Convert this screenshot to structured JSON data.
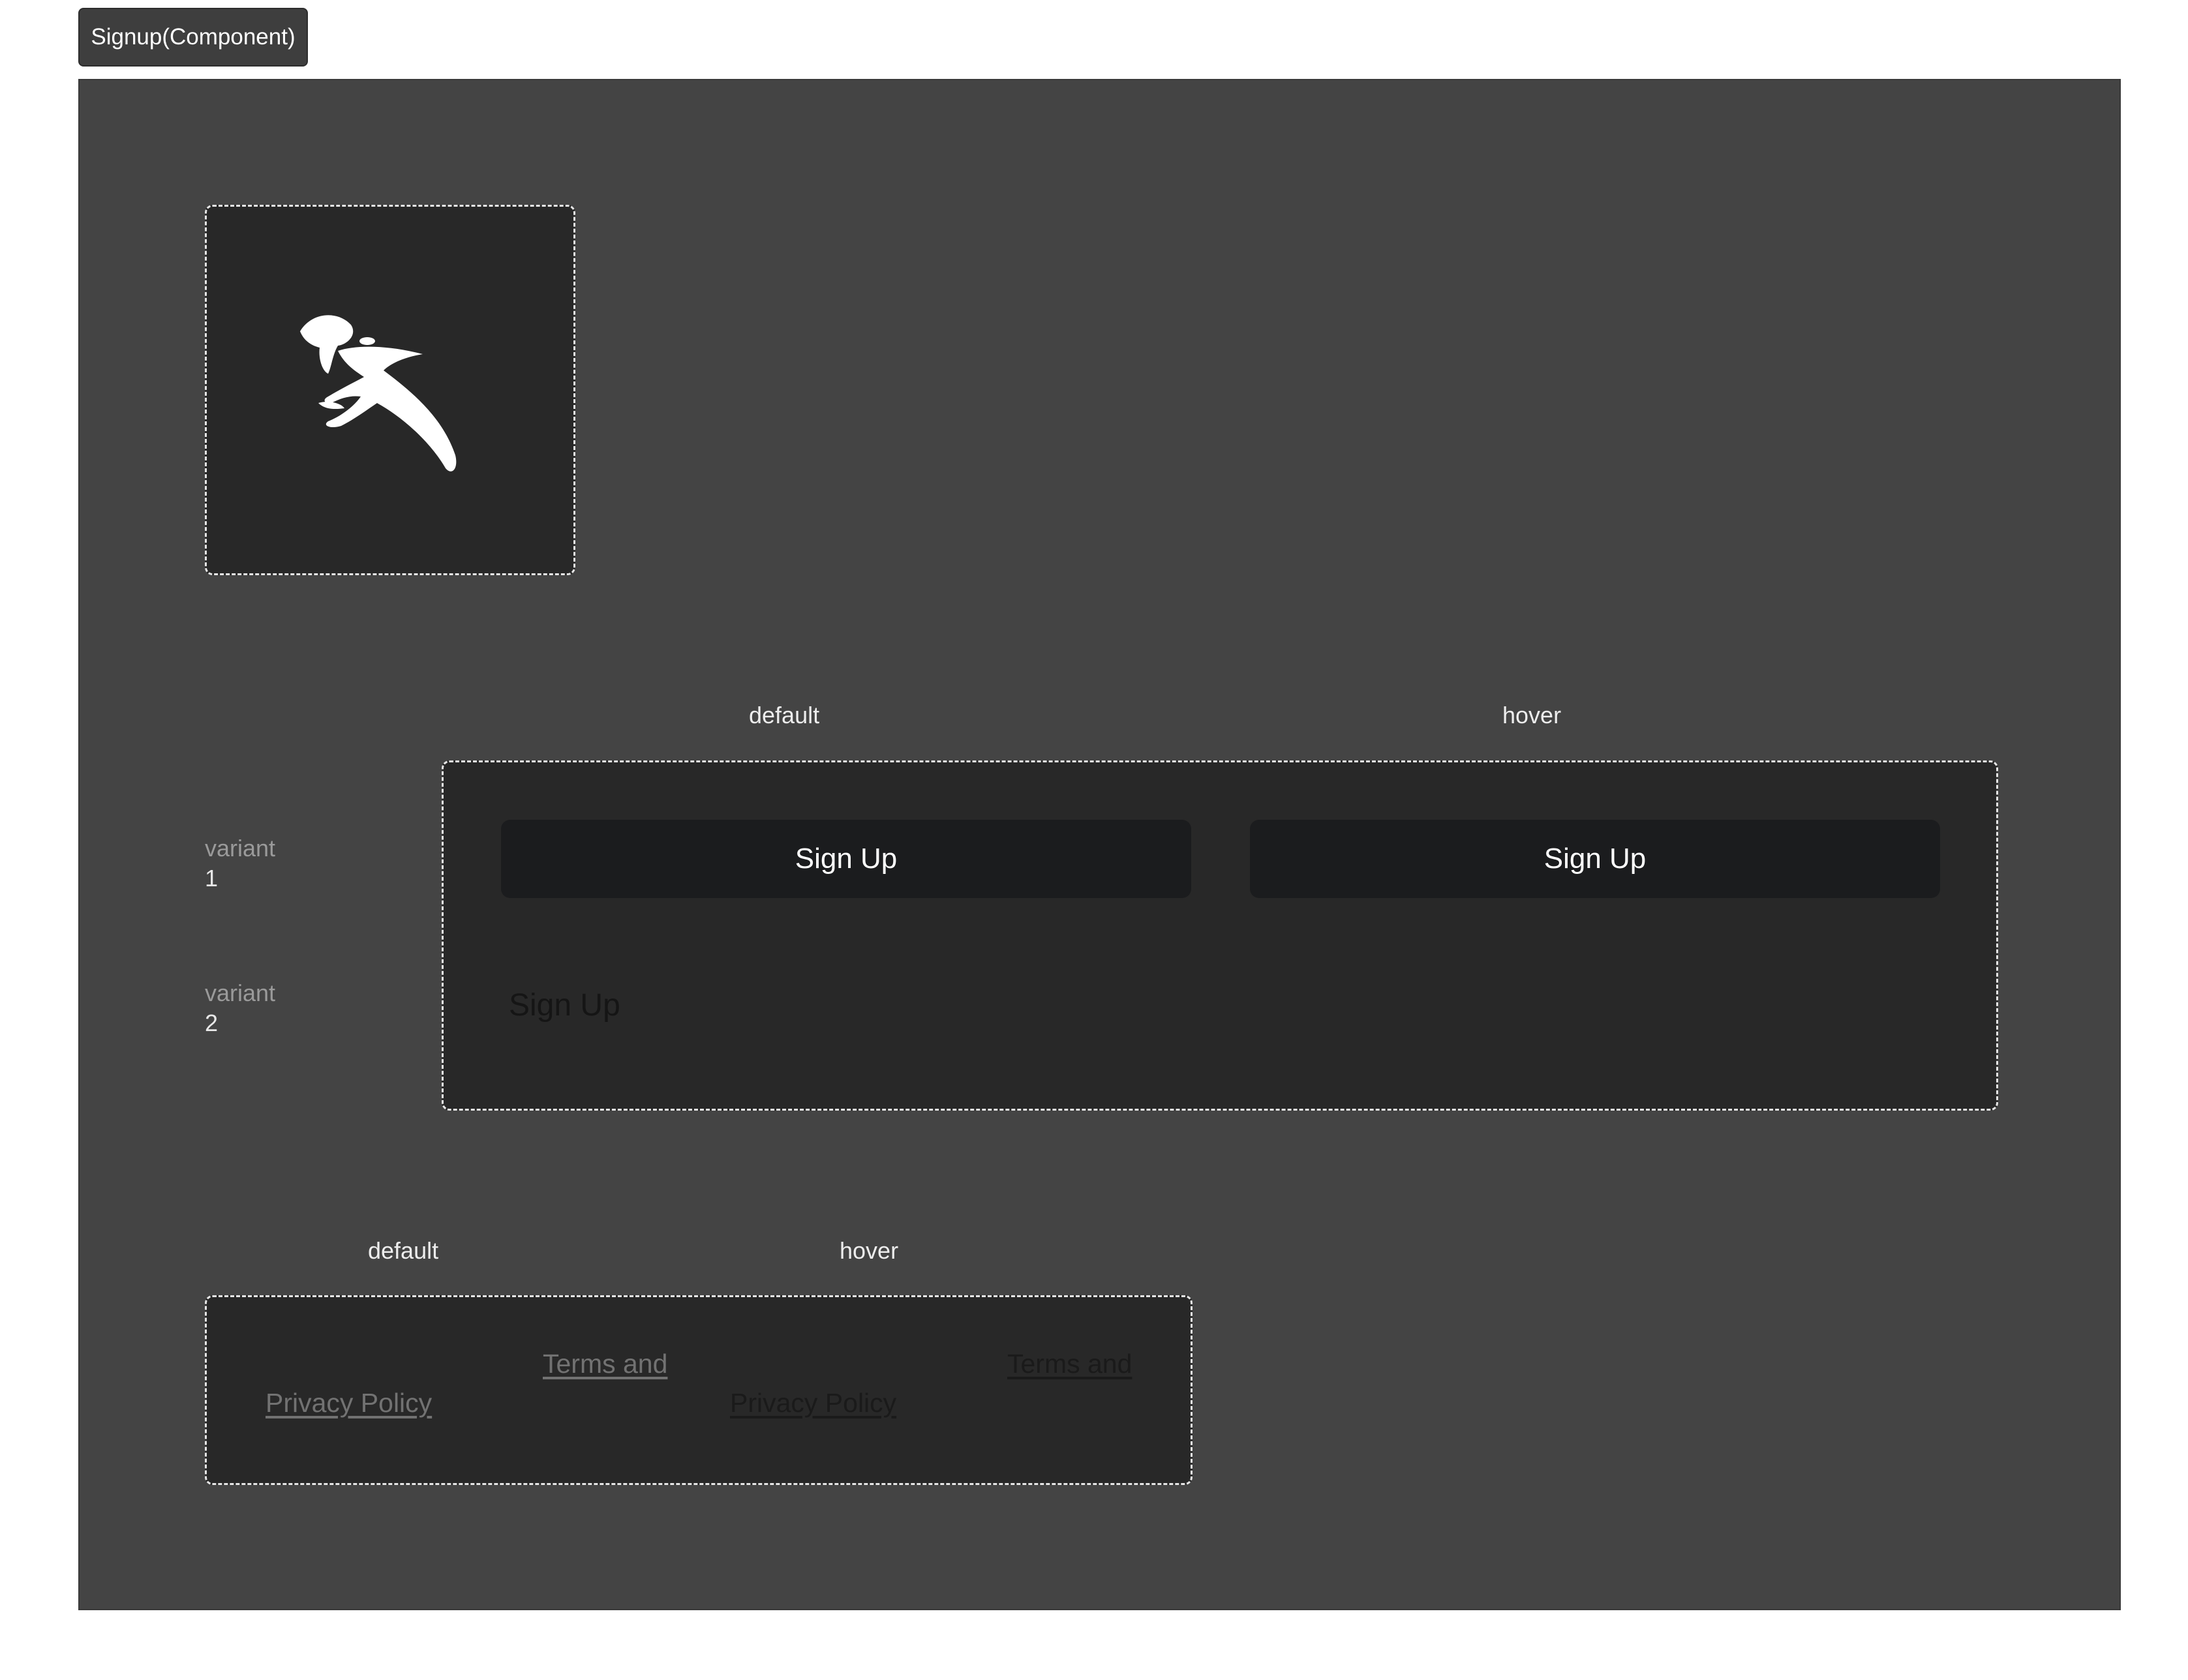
{
  "frame": {
    "title": "Signup(Component)"
  },
  "logo": {
    "icon": "bird-logo-icon",
    "color": "#ffffff"
  },
  "button_section": {
    "columns": [
      "default",
      "hover"
    ],
    "rows": [
      {
        "key": "variant",
        "value": "1"
      },
      {
        "key": "variant",
        "value": "2"
      }
    ],
    "variant1": {
      "default_label": "Sign Up",
      "hover_label": "Sign Up"
    },
    "variant2": {
      "label": "Sign Up"
    }
  },
  "link_section": {
    "columns": [
      "default",
      "hover"
    ],
    "default": {
      "line1": "Terms and",
      "line2": "Privacy Policy"
    },
    "hover": {
      "line1": "Terms and",
      "line2": "Privacy Policy"
    }
  },
  "colors": {
    "canvas": "#444444",
    "panel": "#282828",
    "button": "#1b1c1e",
    "link_default": "#727272",
    "link_hover": "#1a1a1a"
  }
}
